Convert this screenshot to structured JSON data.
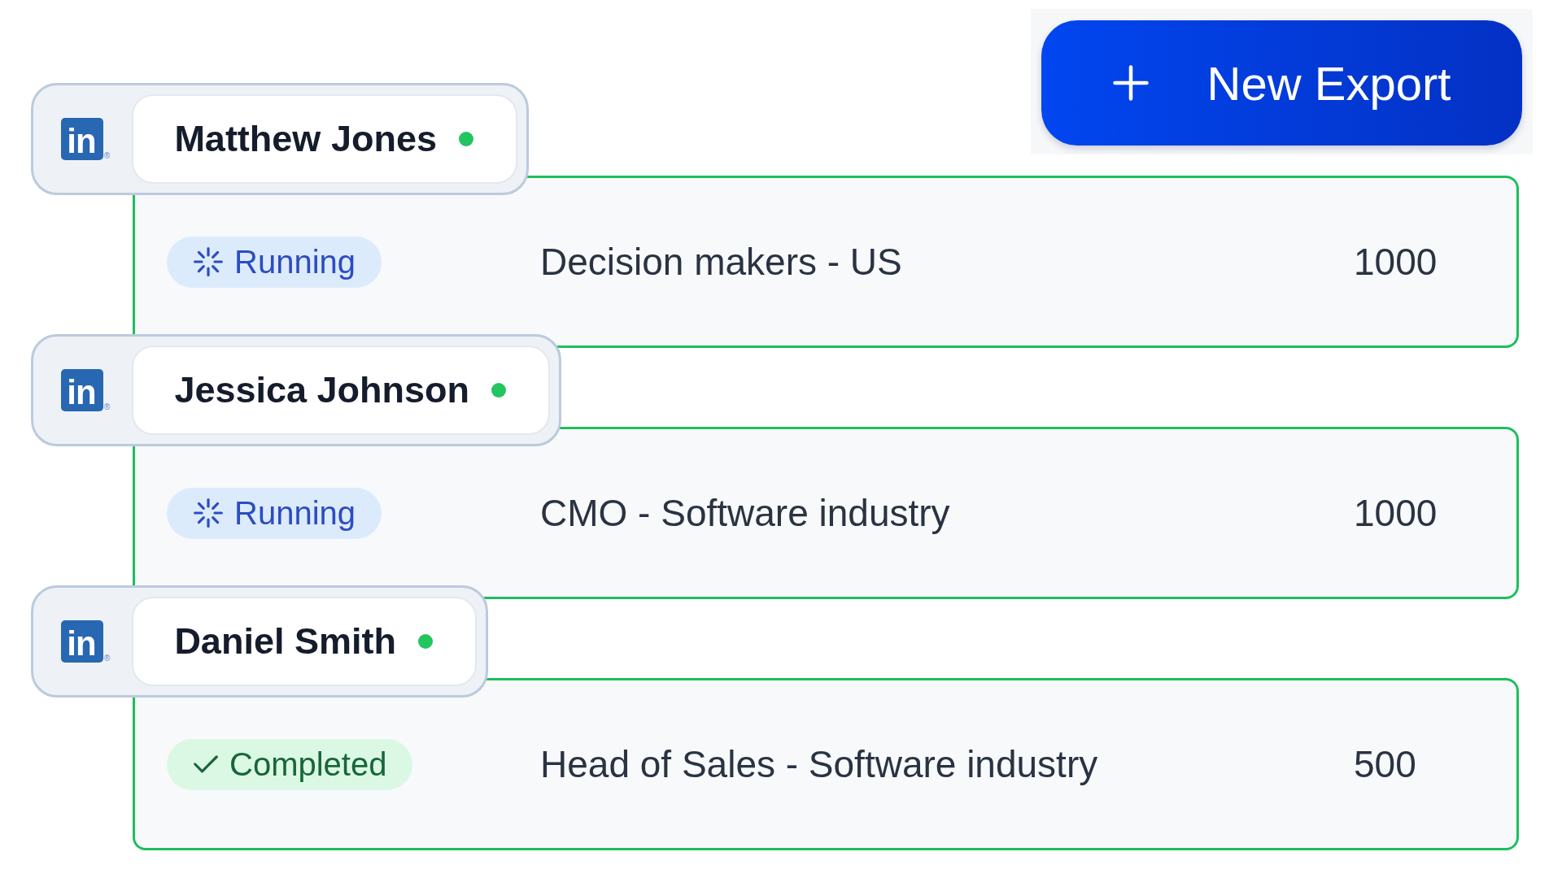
{
  "toolbar": {
    "new_export_button": {
      "label": "New Export"
    }
  },
  "exports": [
    {
      "account": {
        "logo": "in",
        "logo_mark": "®",
        "name": "Matthew Jones",
        "online": true
      },
      "status": {
        "kind": "running",
        "label": "Running"
      },
      "audience": "Decision makers - US",
      "count": "1000"
    },
    {
      "account": {
        "logo": "in",
        "logo_mark": "®",
        "name": "Jessica Johnson",
        "online": true
      },
      "status": {
        "kind": "running",
        "label": "Running"
      },
      "audience": "CMO - Software industry",
      "count": "1000"
    },
    {
      "account": {
        "logo": "in",
        "logo_mark": "®",
        "name": "Daniel Smith",
        "online": true
      },
      "status": {
        "kind": "completed",
        "label": "Completed"
      },
      "audience": "Head of Sales - Software industry",
      "count": "500"
    }
  ]
}
